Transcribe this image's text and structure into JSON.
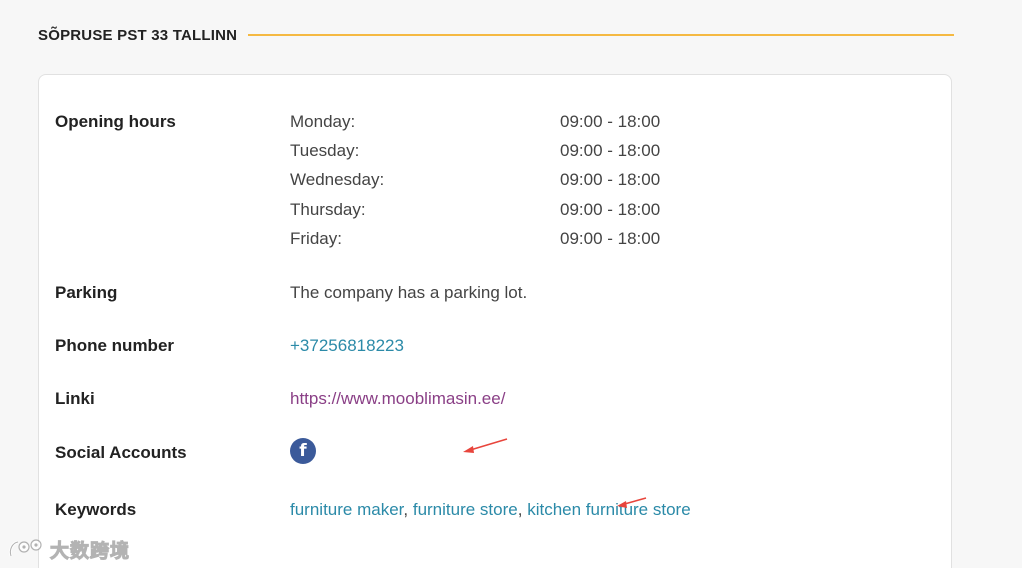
{
  "section": {
    "title": "SÕPRUSE PST 33 TALLINN",
    "accent_color": "#f5b942"
  },
  "opening_hours": {
    "label": "Opening hours",
    "days": [
      {
        "day": "Monday:",
        "time": "09:00 - 18:00"
      },
      {
        "day": "Tuesday:",
        "time": "09:00 - 18:00"
      },
      {
        "day": "Wednesday:",
        "time": "09:00 - 18:00"
      },
      {
        "day": "Thursday:",
        "time": "09:00 - 18:00"
      },
      {
        "day": "Friday:",
        "time": "09:00 - 18:00"
      }
    ]
  },
  "parking": {
    "label": "Parking",
    "value": "The company has a parking lot."
  },
  "phone": {
    "label": "Phone number",
    "value": "+37256818223"
  },
  "link": {
    "label": "Linki",
    "value": "https://www.mooblimasin.ee/"
  },
  "social": {
    "label": "Social Accounts",
    "icons": [
      "facebook-icon"
    ],
    "facebook_glyph": "f"
  },
  "keywords": {
    "label": "Keywords",
    "items": [
      "furniture maker",
      "furniture store",
      "kitchen furniture store"
    ],
    "separator": ","
  },
  "watermark": {
    "text": "大数跨境"
  },
  "colors": {
    "link": "#2b8aa8",
    "visited_link": "#8a3f86",
    "facebook": "#3b5a9a",
    "annotation_arrow": "#e8453c"
  }
}
